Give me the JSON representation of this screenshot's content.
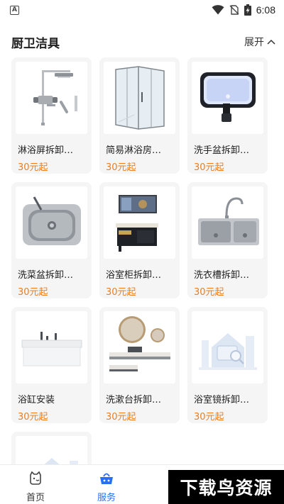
{
  "status_bar": {
    "time": "6:08",
    "notification_badge": "A"
  },
  "section": {
    "title": "厨卫洁具",
    "toggle_label": "展开"
  },
  "items": [
    {
      "title": "淋浴屏拆卸…",
      "price": "30元起",
      "image": "shower-set"
    },
    {
      "title": "简易淋浴房…",
      "price": "30元起",
      "image": "shower-room"
    },
    {
      "title": "洗手盆拆卸…",
      "price": "30元起",
      "image": "wash-basin"
    },
    {
      "title": "洗菜盆拆卸…",
      "price": "30元起",
      "image": "kitchen-sink"
    },
    {
      "title": "浴室柜拆卸…",
      "price": "30元起",
      "image": "bathroom-cabinet"
    },
    {
      "title": "洗衣槽拆卸…",
      "price": "30元起",
      "image": "laundry-sink"
    },
    {
      "title": "浴缸安装",
      "price": "30元起",
      "image": "bathtub"
    },
    {
      "title": "洗漱台拆卸…",
      "price": "30元起",
      "image": "vanity"
    },
    {
      "title": "浴室镜拆卸…",
      "price": "30元起",
      "image": "placeholder"
    }
  ],
  "nav": [
    {
      "label": "首页",
      "icon": "home-face-icon",
      "active": false
    },
    {
      "label": "服务",
      "icon": "service-basket-icon",
      "active": true
    }
  ],
  "watermark": "下载鸟资源",
  "colors": {
    "price": "#ee7d1f",
    "active_nav": "#2a6ff0",
    "card_bg": "#f5f5f5"
  }
}
